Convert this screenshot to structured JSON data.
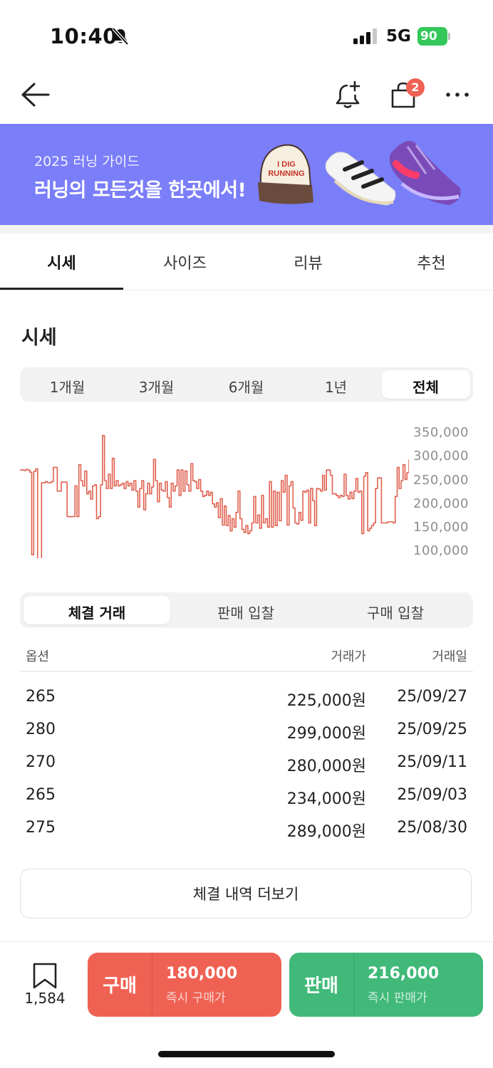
{
  "status_bar": {
    "time": "10:40",
    "network": "5G",
    "battery": "90"
  },
  "header": {
    "cart_badge": "2"
  },
  "banner": {
    "subtitle": "2025 러닝 가이드",
    "title": "러닝의 모든것을 한곳에서!",
    "cap_text_1": "I DIG",
    "cap_text_2": "RUNNING"
  },
  "tabs": [
    "시세",
    "사이즈",
    "리뷰",
    "추천"
  ],
  "section_title": "시세",
  "periods": [
    "1개월",
    "3개월",
    "6개월",
    "1년",
    "전체"
  ],
  "selected_period": "전체",
  "chart_data": {
    "type": "line",
    "color": "#e0604f",
    "y_ticks": [
      "350,000",
      "300,000",
      "250,000",
      "200,000",
      "150,000",
      "100,000"
    ],
    "ylim": [
      100000,
      350000
    ],
    "values": [
      280000,
      280000,
      279000,
      281000,
      280000,
      276000,
      120000,
      277000,
      282000,
      110000,
      105000,
      256000,
      256000,
      258000,
      256000,
      256000,
      258000,
      285000,
      285000,
      240000,
      240000,
      257000,
      257000,
      257000,
      192000,
      192000,
      192000,
      192000,
      250000,
      192000,
      290000,
      260000,
      250000,
      278000,
      235000,
      240000,
      225000,
      250000,
      252000,
      188000,
      192000,
      252000,
      345000,
      260000,
      245000,
      272000,
      245000,
      302000,
      250000,
      260000,
      250000,
      252000,
      255000,
      245000,
      258000,
      250000,
      255000,
      242000,
      260000,
      240000,
      210000,
      245000,
      260000,
      205000,
      235000,
      255000,
      235000,
      248000,
      300000,
      260000,
      220000,
      255000,
      242000,
      240000,
      258000,
      228000,
      210000,
      255000,
      240000,
      250000,
      280000,
      232000,
      280000,
      240000,
      278000,
      252000,
      240000,
      292000,
      260000,
      258000,
      245000,
      262000,
      240000,
      230000,
      232000,
      240000,
      232000,
      238000,
      216000,
      210000,
      218000,
      190000,
      226000,
      176000,
      212000,
      175000,
      194000,
      165000,
      188000,
      172000,
      200000,
      240000,
      188000,
      168000,
      162000,
      175000,
      160000,
      165000,
      180000,
      230000,
      180000,
      195000,
      170000,
      232000,
      180000,
      188000,
      172000,
      258000,
      172000,
      240000,
      175000,
      238000,
      184000,
      260000,
      238000,
      270000,
      176000,
      250000,
      258000,
      208000,
      180000,
      178000,
      200000,
      185000,
      240000,
      238000,
      242000,
      180000,
      245000,
      222000,
      175000,
      245000,
      244000,
      240000,
      270000,
      242000,
      280000,
      280000,
      270000,
      235000,
      235000,
      232000,
      228000,
      232000,
      230000,
      272000,
      232000,
      225000,
      238000,
      226000,
      240000,
      264000,
      238000,
      240000,
      160000,
      268000,
      275000,
      165000,
      170000,
      175000,
      180000,
      245000,
      265000,
      265000,
      180000,
      180000,
      180000,
      182000,
      182000,
      182000,
      180000,
      230000,
      285000,
      245000,
      260000,
      290000,
      262000,
      275000,
      300000
    ]
  },
  "trade_tabs": [
    "체결 거래",
    "판매 입찰",
    "구매 입찰"
  ],
  "table": {
    "headers": [
      "옵션",
      "거래가",
      "거래일"
    ],
    "rows": [
      {
        "option": "265",
        "price": "225,000원",
        "date": "25/09/27"
      },
      {
        "option": "280",
        "price": "299,000원",
        "date": "25/09/25"
      },
      {
        "option": "270",
        "price": "280,000원",
        "date": "25/09/11"
      },
      {
        "option": "265",
        "price": "234,000원",
        "date": "25/09/03"
      },
      {
        "option": "275",
        "price": "289,000원",
        "date": "25/08/30"
      }
    ]
  },
  "more_button": "체결 내역 더보기",
  "bottom": {
    "bookmark_count": "1,584",
    "buy": {
      "label": "구매",
      "price": "180,000",
      "sub": "즉시 구매가",
      "color": "#ef6253"
    },
    "sell": {
      "label": "판매",
      "price": "216,000",
      "sub": "즉시 판매가",
      "color": "#41b979"
    }
  }
}
